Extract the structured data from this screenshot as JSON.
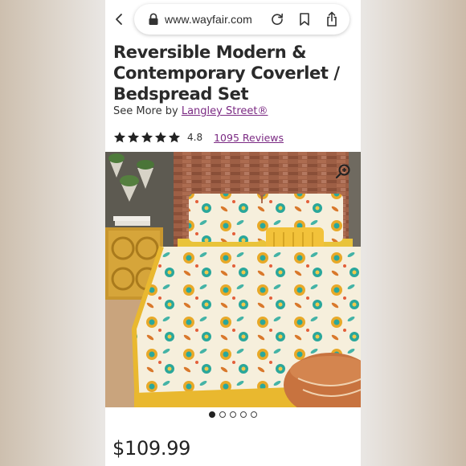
{
  "browser": {
    "url": "www.wayfair.com",
    "icons": [
      "chevron-left-icon",
      "lock-icon",
      "reload-icon",
      "bookmark-icon",
      "share-icon"
    ]
  },
  "product": {
    "title": "Reversible Modern & Contemporary Coverlet / Bedspread Set",
    "see_more_prefix": "See More by",
    "brand": "Langley Street®",
    "rating": {
      "stars": 5,
      "value": "4.8",
      "reviews": "1095 Reviews"
    },
    "image": {
      "zoom_icon": "zoom-in-icon",
      "carousel_count": 5,
      "carousel_active": 1
    },
    "price": "$109.99"
  },
  "colors": {
    "brand_link": "#7b2a83",
    "text": "#2a2a2a",
    "star": "#222222"
  }
}
